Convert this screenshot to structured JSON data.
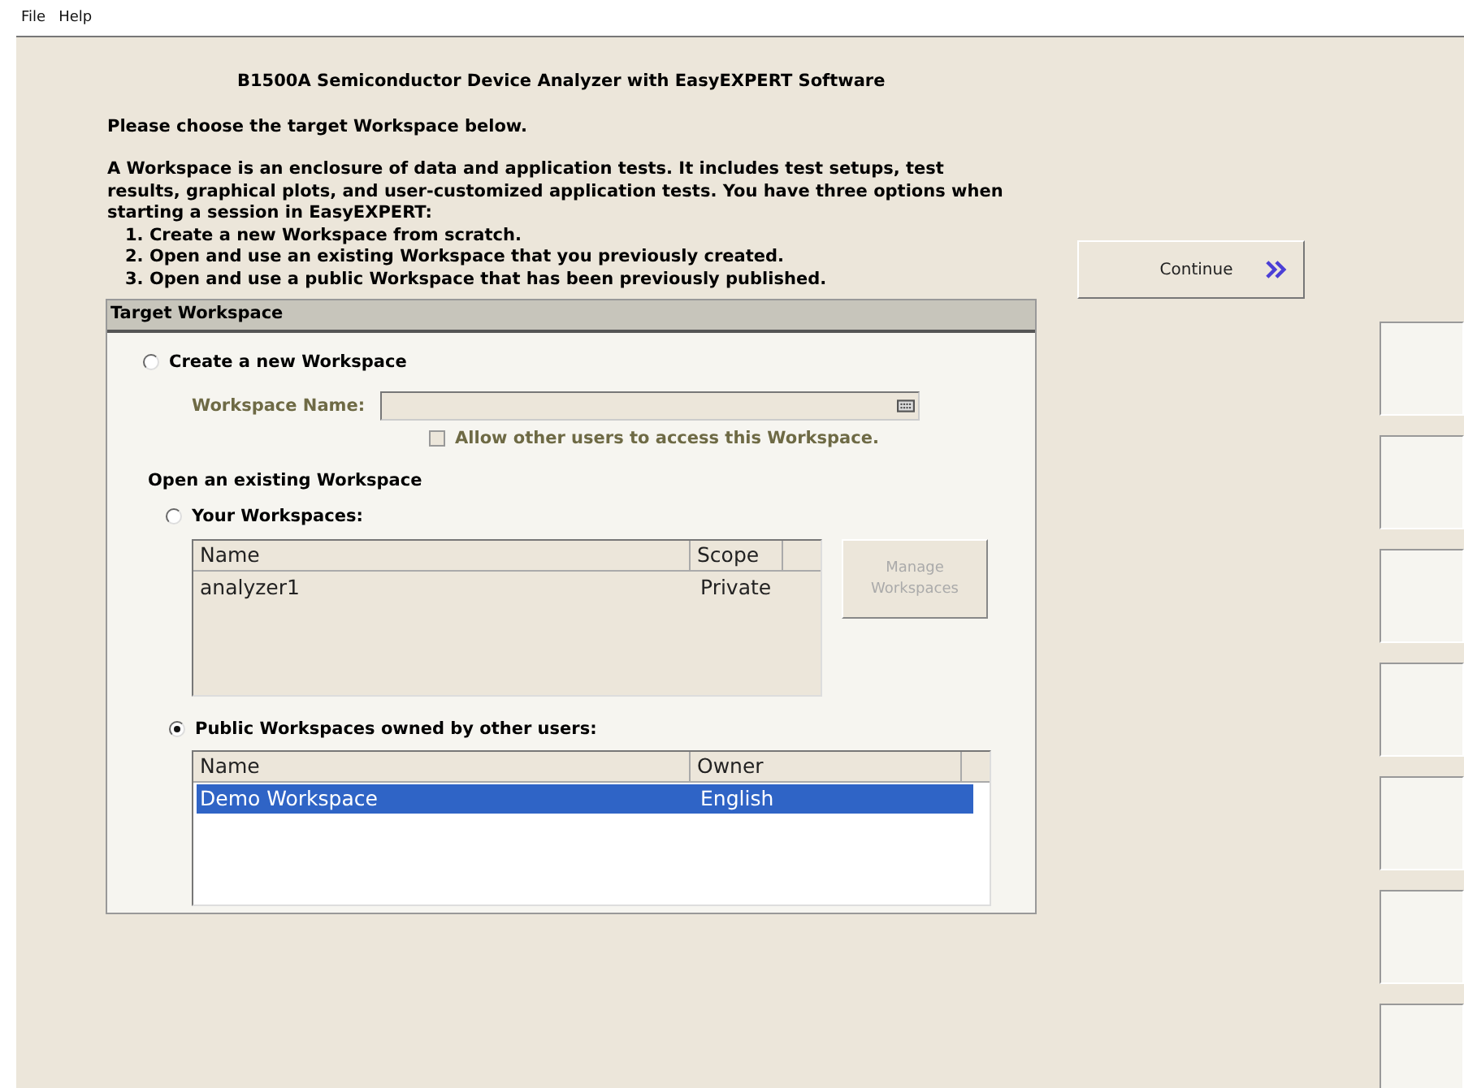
{
  "menu": [
    "File",
    "Help"
  ],
  "title": "B1500A Semiconductor Device Analyzer with EasyEXPERT Software",
  "instruction": "Please choose the target Workspace below.",
  "description": "A Workspace is an enclosure of data and application tests. It includes test setups, test results, graphical plots, and user-customized application tests. You have three options when starting a session in EasyEXPERT:",
  "options_list": [
    "1. Create a new Workspace from scratch.",
    "2. Open and use an existing Workspace that you previously created.",
    "3. Open and use a public Workspace that has been previously published."
  ],
  "continue_button": "Continue",
  "panel": {
    "title": "Target Workspace",
    "create": {
      "label": "Create a new Workspace",
      "selected": false,
      "field_label": "Workspace Name:",
      "disabled": true,
      "checkbox": {
        "label": "Allow other users to access this Workspace.",
        "checked": false
      }
    },
    "open_heading": "Open an existing Workspace",
    "yours": {
      "label": "Your Workspaces:",
      "selected": false,
      "columns": [
        "Name",
        "Scope"
      ],
      "rows": [
        {
          "cells": [
            "analyzer1",
            "Private"
          ],
          "selected": false
        }
      ],
      "disabled": true
    },
    "manage_button": {
      "label": "Manage Workspaces",
      "disabled": true
    },
    "public": {
      "label": "Public Workspaces owned by other users:",
      "selected": true,
      "columns": [
        "Name",
        "Owner"
      ],
      "rows": [
        {
          "cells": [
            "Demo Workspace",
            "English"
          ],
          "selected": true
        }
      ],
      "disabled": false
    }
  }
}
